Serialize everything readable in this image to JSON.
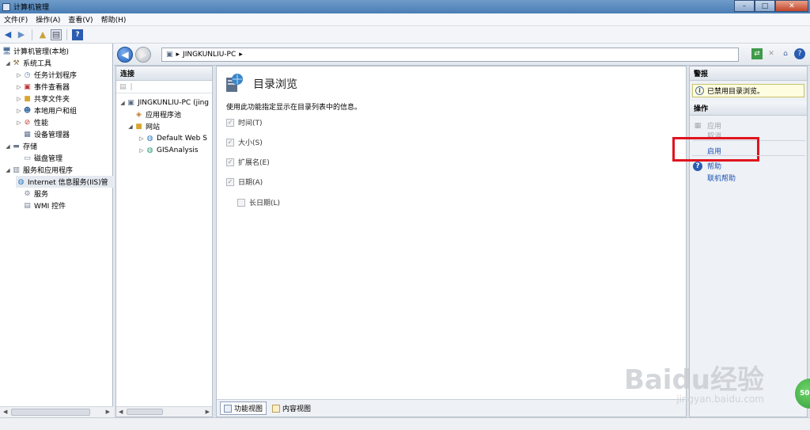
{
  "window": {
    "title": "计算机管理",
    "buttons": {
      "minimize": "–",
      "maximize": "□",
      "close": "✕"
    }
  },
  "menu": [
    "文件(F)",
    "操作(A)",
    "查看(V)",
    "帮助(H)"
  ],
  "tree": {
    "root": "计算机管理(本地)",
    "system_tools": "系统工具",
    "task_scheduler": "任务计划程序",
    "event_viewer": "事件查看器",
    "shared_folders": "共享文件夹",
    "local_users": "本地用户和组",
    "performance": "性能",
    "device_manager": "设备管理器",
    "storage": "存储",
    "disk_mgmt": "磁盘管理",
    "services_apps": "服务和应用程序",
    "iis": "Internet 信息服务(IIS)管",
    "services": "服务",
    "wmi": "WMI 控件"
  },
  "iis": {
    "address": "JINGKUNLIU-PC",
    "connections_header": "连接",
    "conn_tree": {
      "server": "JINGKUNLIU-PC (jing",
      "app_pools": "应用程序池",
      "sites": "网站",
      "default_site": "Default Web S",
      "gis_site": "GISAnalysis"
    }
  },
  "feature": {
    "title": "目录浏览",
    "description": "使用此功能指定显示在目录列表中的信息。",
    "options": [
      {
        "label": "时间(T)",
        "checked": true
      },
      {
        "label": "大小(S)",
        "checked": true
      },
      {
        "label": "扩展名(E)",
        "checked": true
      },
      {
        "label": "日期(A)",
        "checked": true
      },
      {
        "label": "长日期(L)",
        "checked": false
      }
    ],
    "tabs": {
      "features_view": "功能视图",
      "content_view": "内容视图"
    }
  },
  "actions": {
    "alerts_header": "警报",
    "alert_text": "已禁用目录浏览。",
    "actions_header": "操作",
    "apply": "应用",
    "cancel": "取消",
    "enable": "启用",
    "help": "帮助",
    "online_help": "联机帮助",
    "highlight_color": "#e0141e"
  },
  "watermark": {
    "brand": "Baidu经验",
    "url": "jingyan.baidu.com"
  },
  "badge": "50"
}
